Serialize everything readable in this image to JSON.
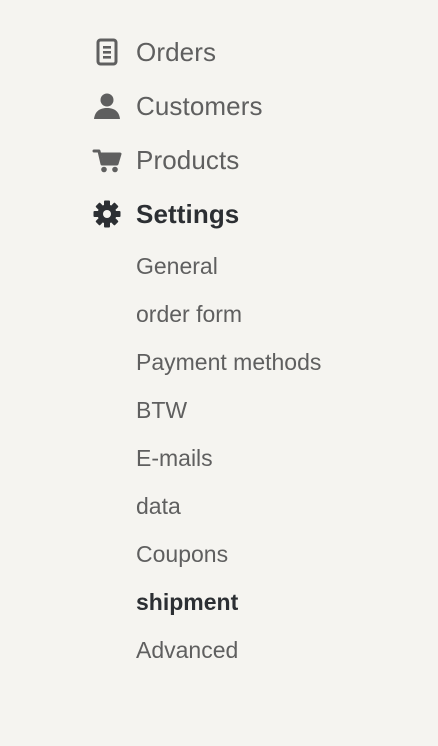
{
  "menu": {
    "items": [
      {
        "label": "Orders",
        "icon": "document-icon",
        "active": false
      },
      {
        "label": "Customers",
        "icon": "user-icon",
        "active": false
      },
      {
        "label": "Products",
        "icon": "shopping-cart-icon",
        "active": false
      },
      {
        "label": "Settings",
        "icon": "gear-icon",
        "active": true
      }
    ]
  },
  "settings_submenu": {
    "items": [
      {
        "label": "General",
        "active": false
      },
      {
        "label": "order form",
        "active": false
      },
      {
        "label": "Payment methods",
        "active": false
      },
      {
        "label": "BTW",
        "active": false
      },
      {
        "label": "E-mails",
        "active": false
      },
      {
        "label": "data",
        "active": false
      },
      {
        "label": "Coupons",
        "active": false
      },
      {
        "label": "shipment",
        "active": true
      },
      {
        "label": "Advanced",
        "active": false
      }
    ]
  },
  "colors": {
    "background": "#f5f4f0",
    "text": "#5f5f5f",
    "active_text": "#2c2f33"
  }
}
